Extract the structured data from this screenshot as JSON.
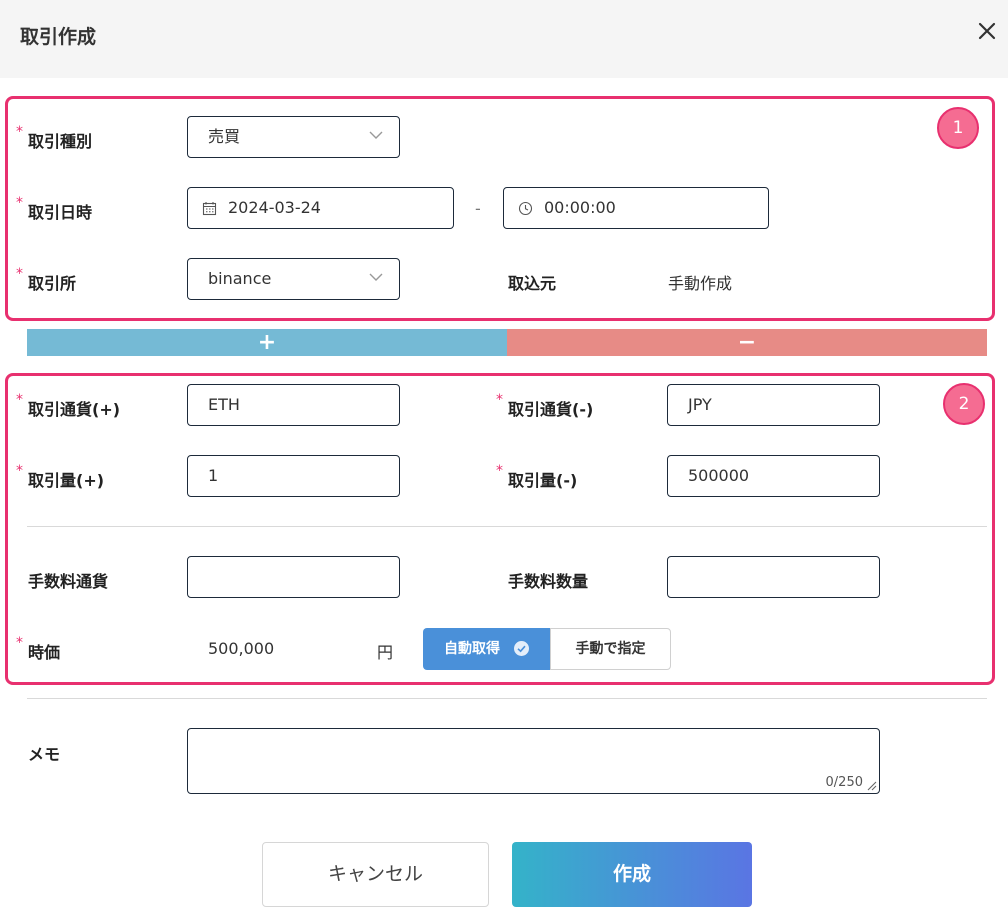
{
  "header": {
    "title": "取引作成",
    "close_icon": "close-icon"
  },
  "section1": {
    "badge": "1",
    "type": {
      "label": "取引種別",
      "value": "売買"
    },
    "datetime": {
      "label": "取引日時",
      "date": "2024-03-24",
      "separator": "-",
      "time": "00:00:00"
    },
    "exchange": {
      "label": "取引所",
      "value": "binance"
    },
    "source": {
      "label": "取込元",
      "value": "手動作成"
    }
  },
  "bars": {
    "plus": "+",
    "minus": "−",
    "plus_color": "#75bad5",
    "minus_color": "#e78b86"
  },
  "section2": {
    "badge": "2",
    "currency_plus": {
      "label": "取引通貨(+)",
      "value": "ETH"
    },
    "currency_minus": {
      "label": "取引通貨(-)",
      "value": "JPY"
    },
    "amount_plus": {
      "label": "取引量(+)",
      "value": "1"
    },
    "amount_minus": {
      "label": "取引量(-)",
      "value": "500000"
    },
    "fee_currency": {
      "label": "手数料通貨",
      "value": ""
    },
    "fee_amount": {
      "label": "手数料数量",
      "value": ""
    },
    "price": {
      "label": "時価",
      "value": "500,000",
      "unit": "円",
      "auto_label": "自動取得",
      "manual_label": "手動で指定"
    }
  },
  "memo": {
    "label": "メモ",
    "value": "",
    "counter": "0/250"
  },
  "footer": {
    "cancel_label": "キャンセル",
    "create_label": "作成"
  },
  "colors": {
    "accent_pink": "#e8306f",
    "auto_blue": "#4a90d9",
    "gradient_start": "#34b3c9",
    "gradient_end": "#5a75e3"
  },
  "required_mark": "*"
}
